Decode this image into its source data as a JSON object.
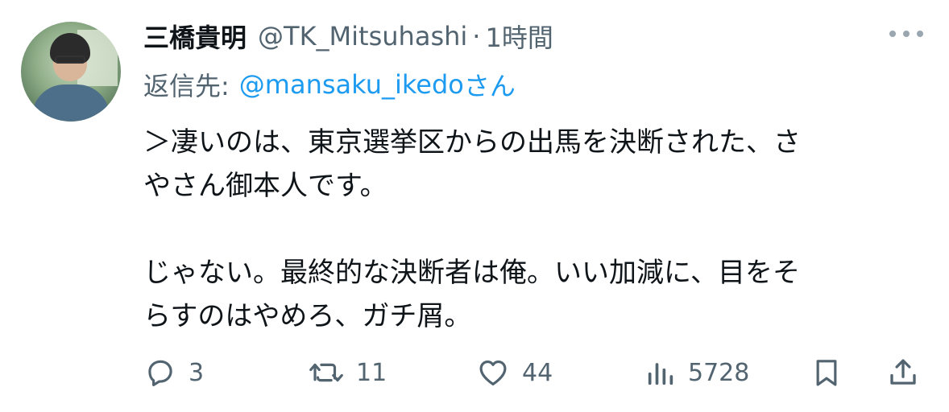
{
  "author": {
    "display_name": "三橋貴明",
    "handle": "@TK_Mitsuhashi",
    "separator": "·",
    "time": "1時間"
  },
  "reply": {
    "prefix": "返信先:",
    "user": "@mansaku_ikedo",
    "suffix": "さん"
  },
  "tweet": {
    "line1": "＞凄いのは、東京選挙区からの出馬を決断された、さ",
    "line2": "やさん御本人です。",
    "line3": "じゃない。最終的な決断者は俺。いい加減に、目をそ",
    "line4": "らすのはやめろ、ガチ屑。"
  },
  "actions": {
    "replies": "3",
    "retweets": "11",
    "likes": "44",
    "views": "5728"
  },
  "icons": {
    "more": "more-horizontal-icon",
    "reply": "reply-icon",
    "retweet": "retweet-icon",
    "like": "heart-icon",
    "views": "views-chart-icon",
    "bookmark": "bookmark-icon",
    "share": "share-icon"
  },
  "colors": {
    "text": "#0f1419",
    "secondary": "#536471",
    "link": "#1d9bf0"
  }
}
